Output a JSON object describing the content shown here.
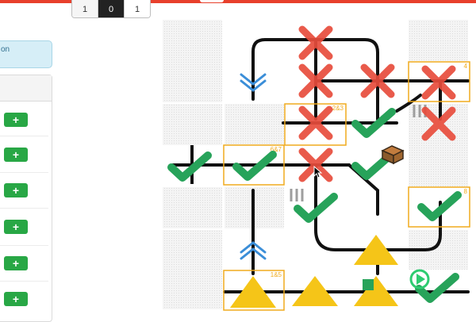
{
  "segmented": {
    "options": [
      "1",
      "0",
      "1"
    ],
    "active_index": 1
  },
  "banner": {
    "text": "on"
  },
  "sidebar": {
    "add_buttons": [
      "+",
      "+",
      "+",
      "+",
      "+",
      "+"
    ]
  },
  "board": {
    "tile_labels": [
      "2&3",
      "4",
      "6&7",
      "8",
      "1&5"
    ],
    "colors": {
      "track": "#111111",
      "cross": "#e74c3c",
      "check": "#27a35a",
      "triangle": "#f5c518",
      "frame": "#f0ab1e",
      "chevron": "#3b8ed8",
      "stripes": "#9e9e9e",
      "play": "#2ecc71"
    }
  }
}
